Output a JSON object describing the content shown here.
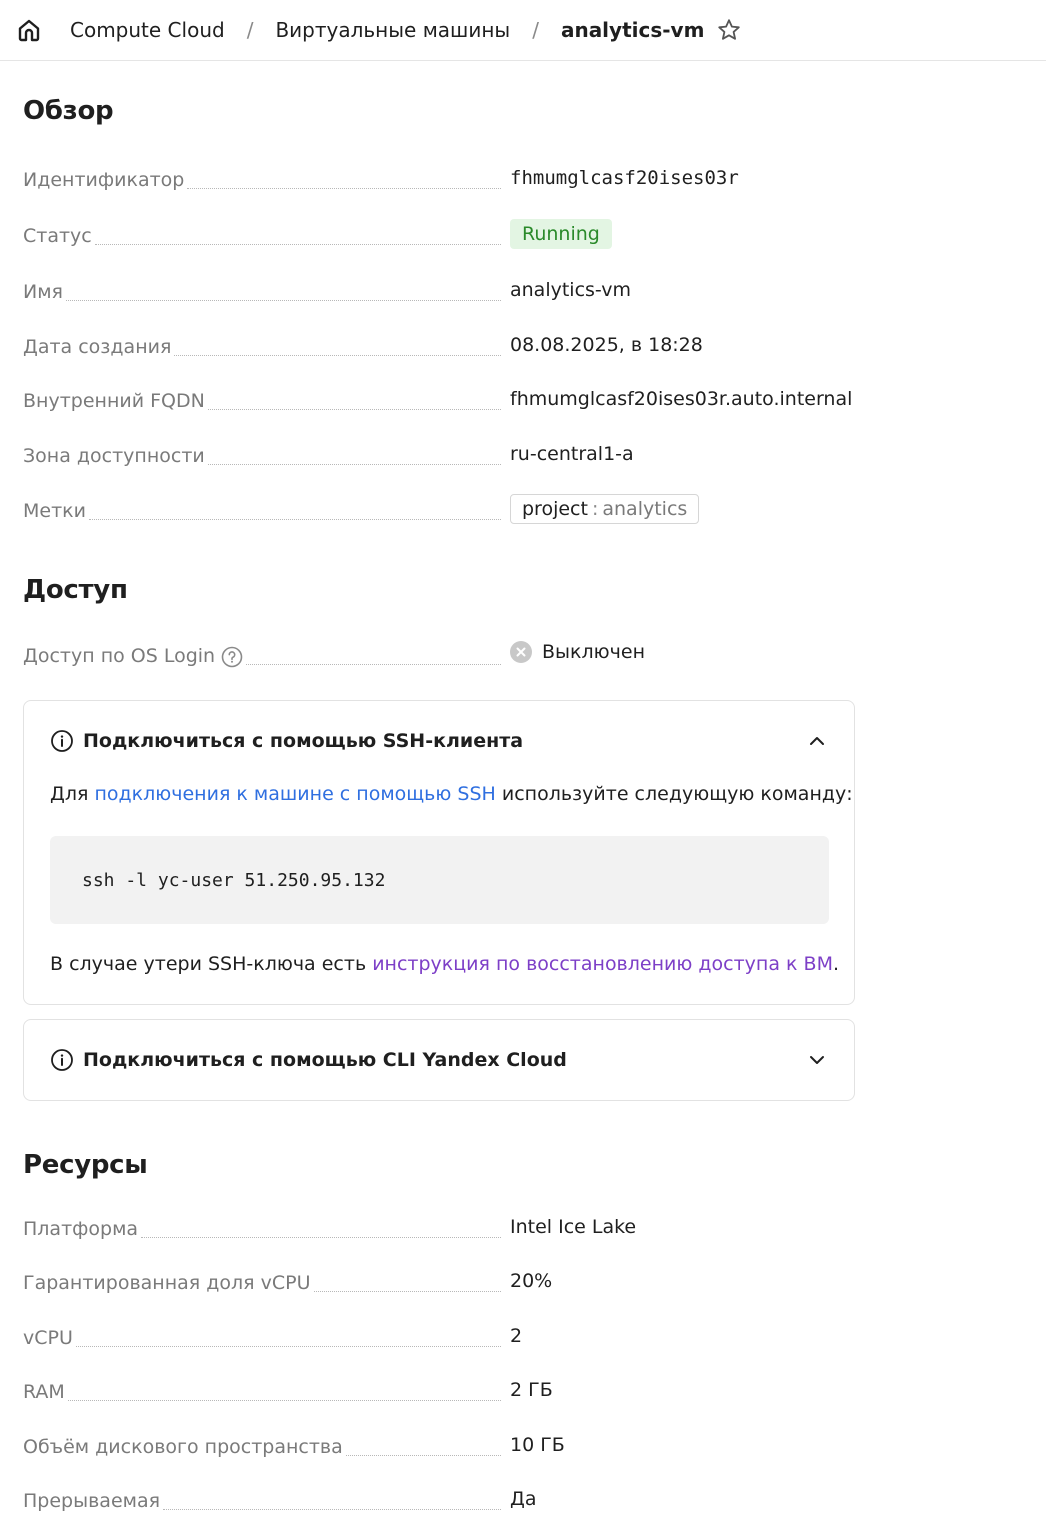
{
  "breadcrumbs": {
    "home_icon": "home-icon",
    "items": [
      "Compute Cloud",
      "Виртуальные машины"
    ],
    "separator": "/",
    "current": "analytics-vm",
    "star_icon": "star-icon"
  },
  "overview": {
    "title": "Обзор",
    "rows": {
      "id": {
        "label": "Идентификатор",
        "value": "fhmumglcasf20ises03r"
      },
      "status": {
        "label": "Статус",
        "value": "Running"
      },
      "name": {
        "label": "Имя",
        "value": "analytics-vm"
      },
      "created": {
        "label": "Дата создания",
        "value": "08.08.2025, в 18:28"
      },
      "fqdn": {
        "label": "Внутренний FQDN",
        "value": "fhmumglcasf20ises03r.auto.internal"
      },
      "zone": {
        "label": "Зона доступности",
        "value": "ru-central1-a"
      },
      "labels": {
        "label": "Метки",
        "tag_key": "project",
        "tag_sep": ":",
        "tag_value": "analytics"
      }
    }
  },
  "access": {
    "title": "Доступ",
    "os_login": {
      "label": "Доступ по OS Login",
      "value": "Выключен"
    },
    "ssh_card": {
      "title": "Подключиться с помощью SSH-клиента",
      "text_before": "Для ",
      "link": "подключения к машине с помощью SSH",
      "text_after": " используйте следующую команду:",
      "command": "ssh -l yc-user 51.250.95.132",
      "recovery_before": "В случае утери SSH-ключа есть ",
      "recovery_link": "инструкция по восстановлению доступа к ВМ",
      "recovery_after": "."
    },
    "cli_card": {
      "title": "Подключиться с помощью CLI Yandex Cloud"
    }
  },
  "resources": {
    "title": "Ресурсы",
    "rows": {
      "platform": {
        "label": "Платформа",
        "value": "Intel Ice Lake"
      },
      "core_fraction": {
        "label": "Гарантированная доля vCPU",
        "value": "20%"
      },
      "vcpu": {
        "label": "vCPU",
        "value": "2"
      },
      "ram": {
        "label": "RAM",
        "value": "2 ГБ"
      },
      "disk": {
        "label": "Объём дискового пространства",
        "value": "10 ГБ"
      },
      "preemptible": {
        "label": "Прерываемая",
        "value": "Да"
      }
    }
  },
  "colors": {
    "running_bg": "#e3f5e3",
    "running_text": "#2a8a2a",
    "link_blue": "#2f6fe0",
    "link_purple": "#7d3fc7"
  }
}
